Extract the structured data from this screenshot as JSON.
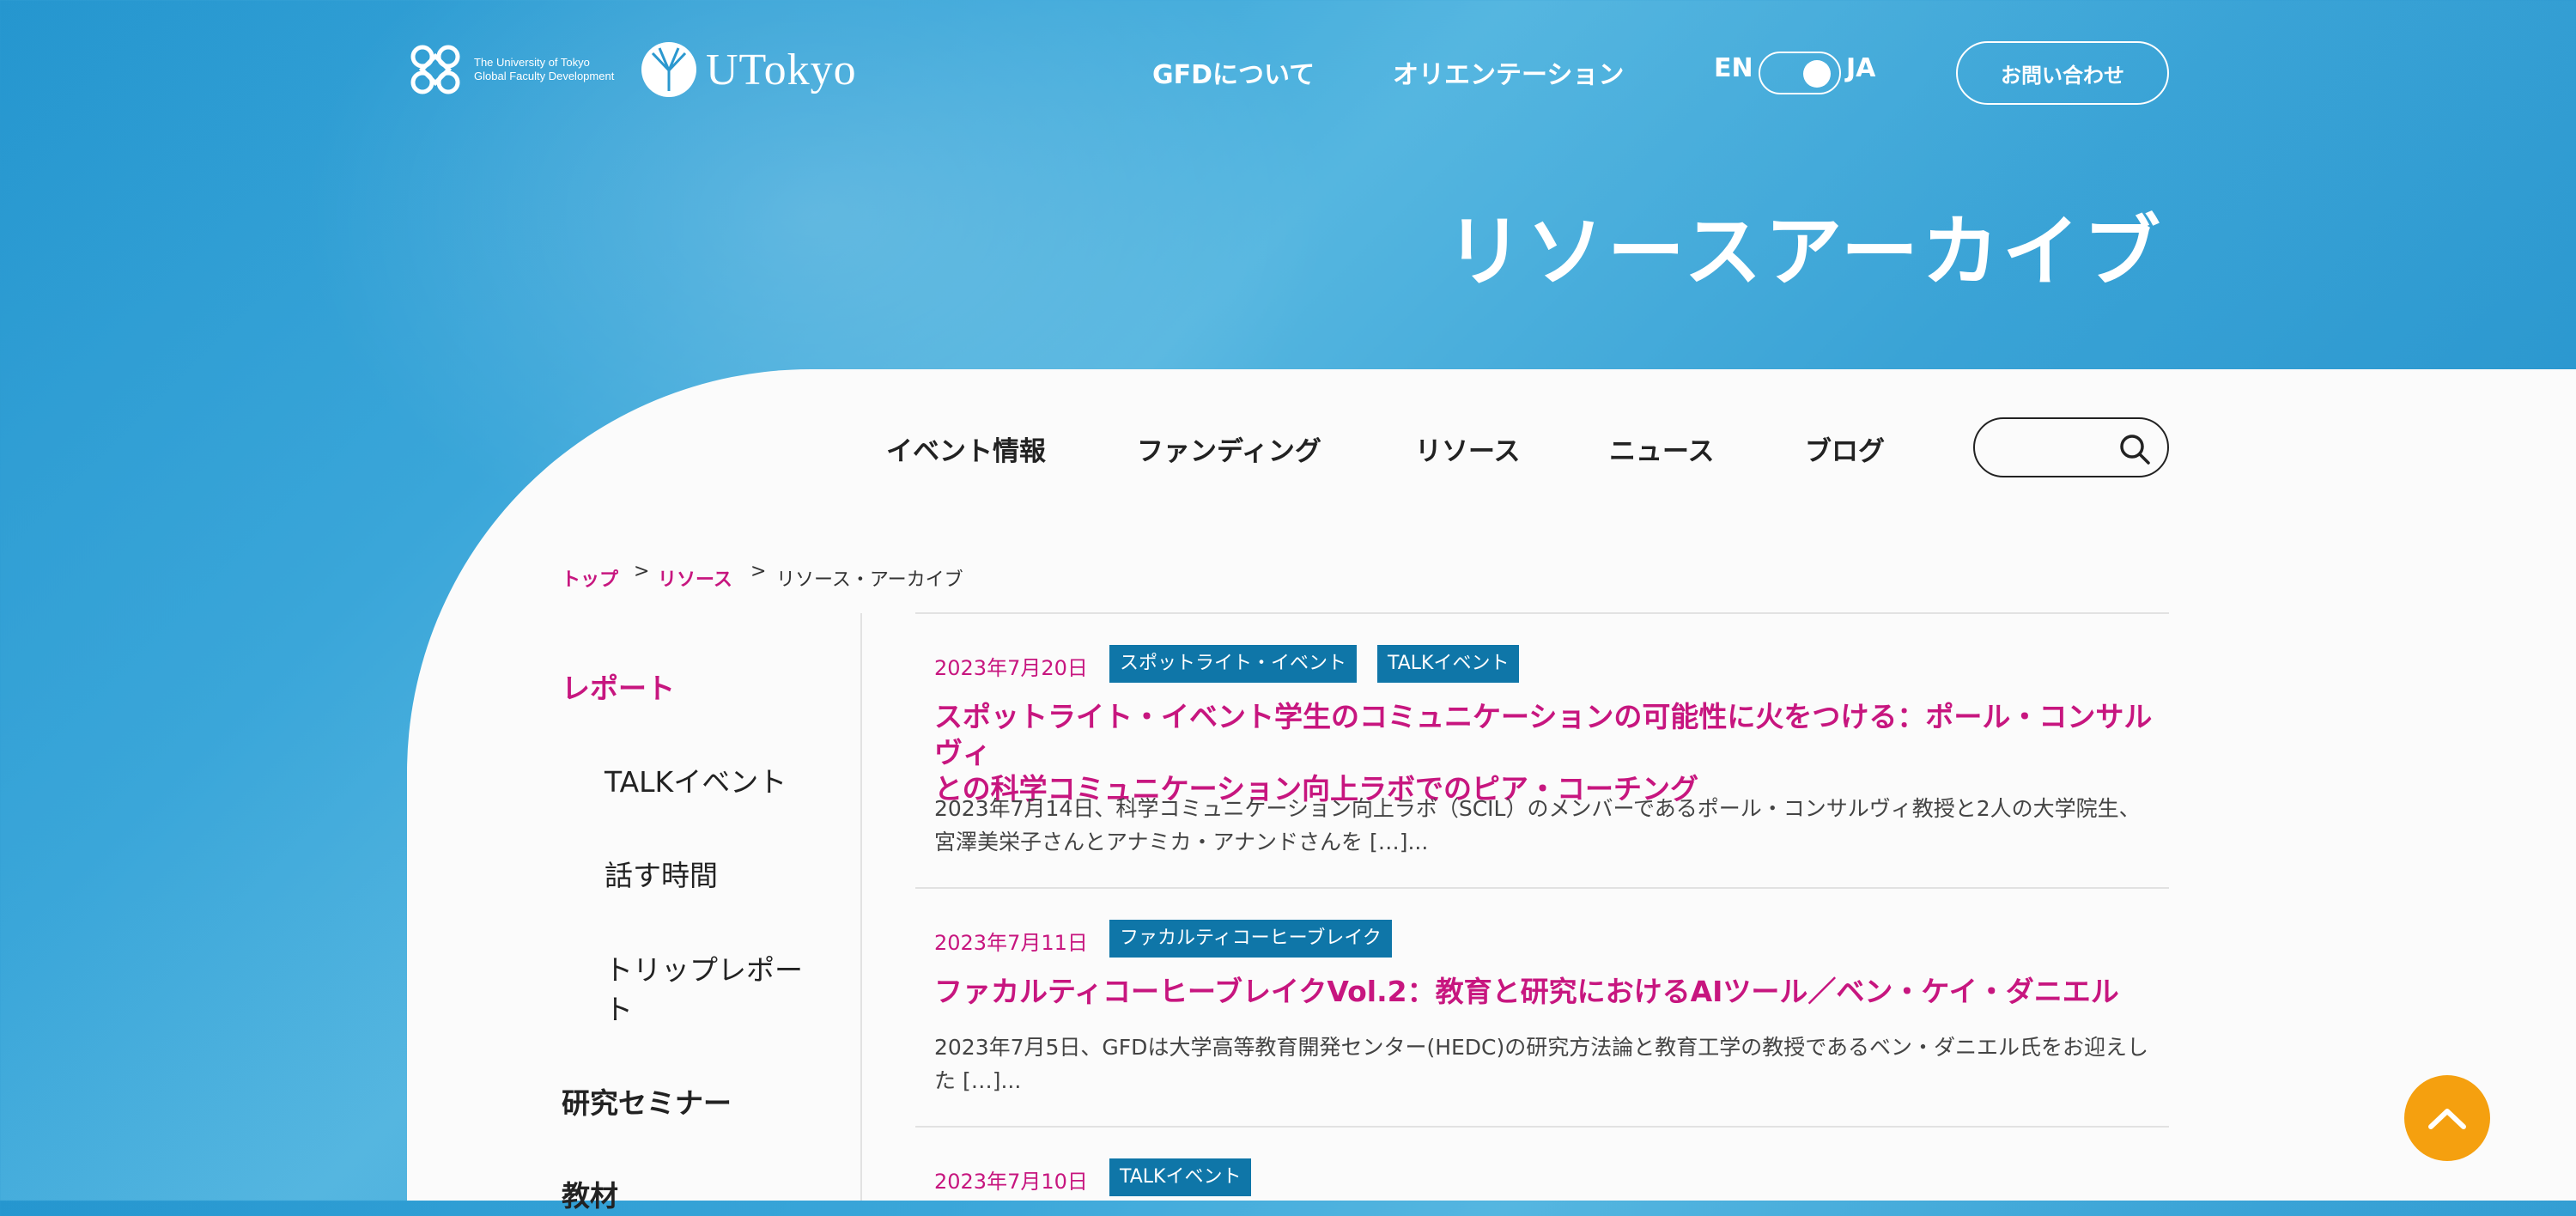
{
  "header": {
    "gfd_logo": {
      "line1": "The University of Tokyo",
      "line2": "Global Faculty Development"
    },
    "utokyo_logo": "UTokyo",
    "nav": [
      "GFDについて",
      "オリエンテーション"
    ],
    "lang": {
      "en": "EN",
      "ja": "JA",
      "selected": "JA"
    },
    "contact_label": "お問い合わせ"
  },
  "page_title": "リソースアーカイブ",
  "main_nav": [
    "イベント情報",
    "ファンディング",
    "リソース",
    "ニュース",
    "ブログ"
  ],
  "search": {
    "placeholder": ""
  },
  "breadcrumb": {
    "top": "トップ",
    "resources": "リソース",
    "current": "リソース・アーカイブ",
    "sep": ">"
  },
  "sidebar": {
    "report": "レポート",
    "sub": [
      "TALKイベント",
      "話す時間",
      "トリップレポート"
    ],
    "seminar": "研究セミナー",
    "materials": "教材"
  },
  "posts": [
    {
      "date": "2023年7月20日",
      "tags": [
        "スポットライト・イベント",
        "TALKイベント"
      ],
      "title_line1": "スポットライト・イベント学生のコミュニケーションの可能性に火をつける：ポール・コンサルヴィ",
      "title_line2": "との科学コミュニケーション向上ラボでのピア・コーチング",
      "excerpt_line1": "2023年7月14日、科学コミュニケーション向上ラボ（SCIL）のメンバーであるポール・コンサルヴィ教授と2人の大学院生、",
      "excerpt_line2": "宮澤美栄子さんとアナミカ・アナンドさんを […]..."
    },
    {
      "date": "2023年7月11日",
      "tags": [
        "ファカルティコーヒーブレイク"
      ],
      "title_line1": "ファカルティコーヒーブレイクVol.2：教育と研究におけるAIツール／ベン・ケイ・ダニエル",
      "excerpt_line1": "2023年7月5日、GFDは大学高等教育開発センター(HEDC)の研究方法論と教育工学の教授であるベン・ダニエル氏をお迎えし",
      "excerpt_line2": "た […]..."
    },
    {
      "date": "2023年7月10日",
      "tags": [
        "TALKイベント"
      ]
    }
  ],
  "colors": {
    "accent": "#c7167f",
    "tag_bg": "#0f76a8",
    "hero": "#2a97cf",
    "to_top": "#f5a00f"
  },
  "icons": {
    "search": "search-icon",
    "to_top": "chevron-up-icon"
  }
}
